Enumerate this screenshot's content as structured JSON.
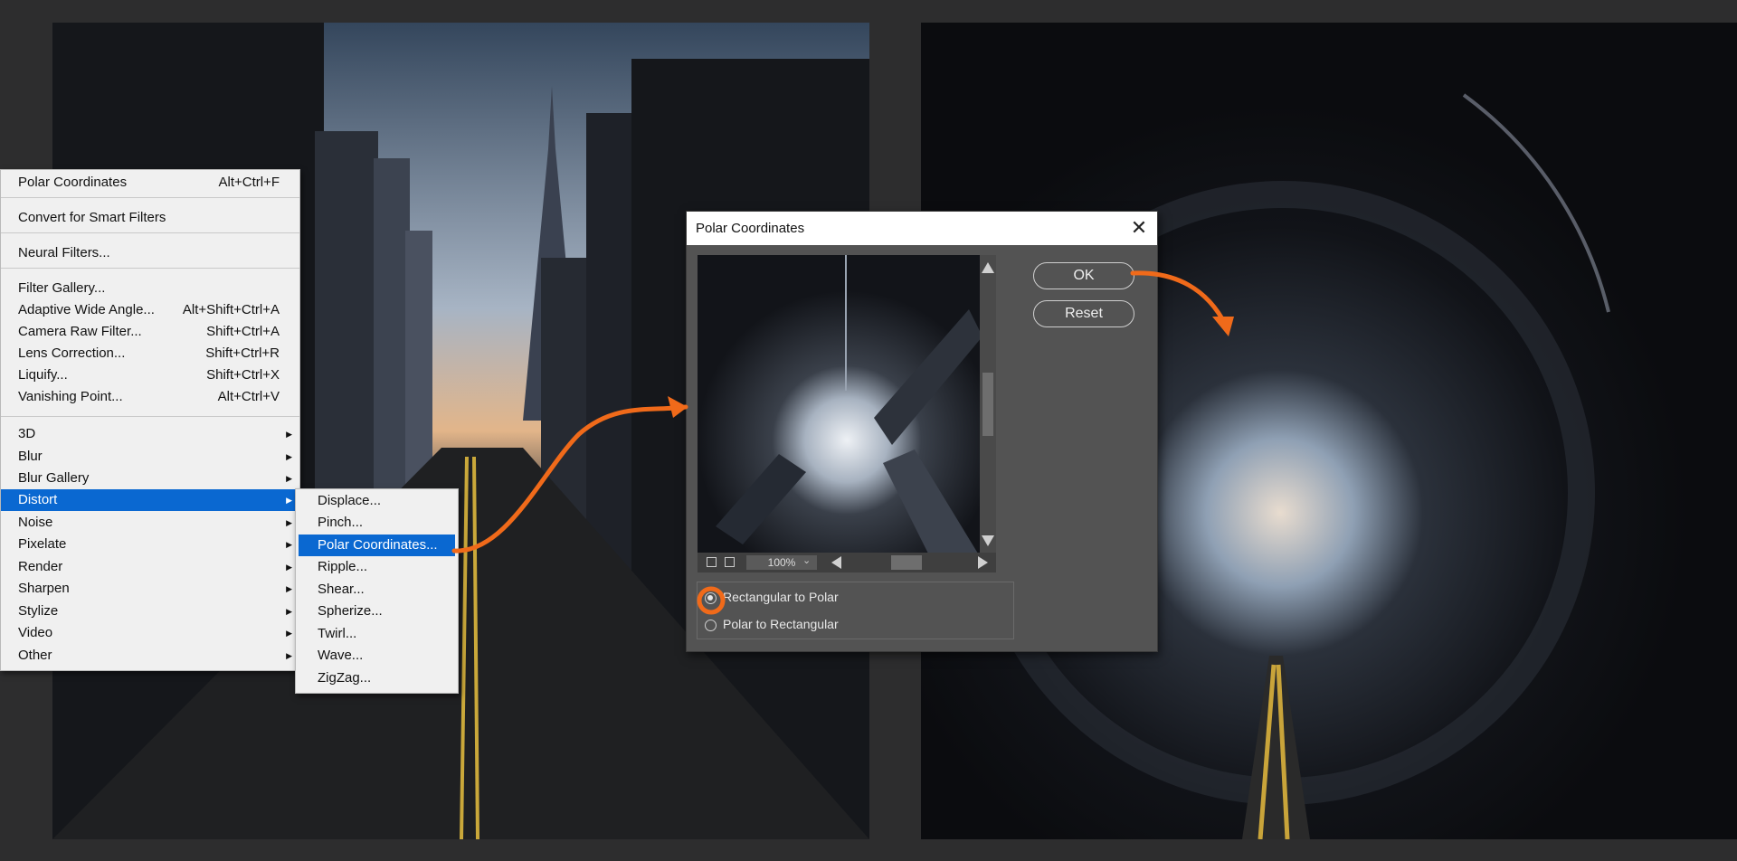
{
  "menu": {
    "last_filter": {
      "label": "Polar Coordinates",
      "shortcut": "Alt+Ctrl+F"
    },
    "convert": "Convert for Smart Filters",
    "neural": "Neural Filters...",
    "group1": [
      {
        "label": "Filter Gallery...",
        "shortcut": ""
      },
      {
        "label": "Adaptive Wide Angle...",
        "shortcut": "Alt+Shift+Ctrl+A"
      },
      {
        "label": "Camera Raw Filter...",
        "shortcut": "Shift+Ctrl+A"
      },
      {
        "label": "Lens Correction...",
        "shortcut": "Shift+Ctrl+R"
      },
      {
        "label": "Liquify...",
        "shortcut": "Shift+Ctrl+X"
      },
      {
        "label": "Vanishing Point...",
        "shortcut": "Alt+Ctrl+V"
      }
    ],
    "group2": [
      "3D",
      "Blur",
      "Blur Gallery",
      "Distort",
      "Noise",
      "Pixelate",
      "Render",
      "Sharpen",
      "Stylize",
      "Video",
      "Other"
    ],
    "arrow": "▶"
  },
  "submenu": [
    "Displace...",
    "Pinch...",
    "Polar Coordinates...",
    "Ripple...",
    "Shear...",
    "Spherize...",
    "Twirl...",
    "Wave...",
    "ZigZag..."
  ],
  "dialog": {
    "title": "Polar Coordinates",
    "close": "✕",
    "ok": "OK",
    "reset": "Reset",
    "zoom": "100%",
    "option_rect_to_polar": "Rectangular to Polar",
    "option_polar_to_rect": "Polar to Rectangular",
    "selected_option": "Rectangular to Polar"
  },
  "colors": {
    "highlight": "#0a68d1",
    "accent_arrow": "#f06a1a"
  }
}
